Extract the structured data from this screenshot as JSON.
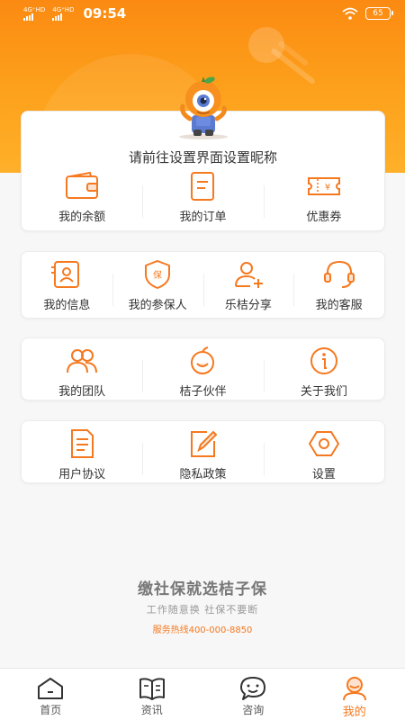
{
  "status_bar": {
    "signal_1": "4G⁺HD",
    "signal_2": "4G⁺HD",
    "time": "09:54",
    "battery": "65"
  },
  "colors": {
    "accent": "#f5791f",
    "header": "#fb8a12",
    "page_bg": "#f7f7f7"
  },
  "profile": {
    "nickname": "请前往设置界面设置昵称",
    "items": [
      {
        "label": "我的余额",
        "icon": "wallet-icon"
      },
      {
        "label": "我的订单",
        "icon": "order-icon"
      },
      {
        "label": "优惠券",
        "icon": "coupon-icon"
      }
    ]
  },
  "menu_group_1": [
    {
      "label": "我的信息",
      "icon": "id-card-icon"
    },
    {
      "label": "我的参保人",
      "icon": "shield-icon"
    },
    {
      "label": "乐桔分享",
      "icon": "user-add-icon"
    },
    {
      "label": "我的客服",
      "icon": "headset-icon"
    }
  ],
  "menu_group_2": [
    {
      "label": "我的团队",
      "icon": "team-icon"
    },
    {
      "label": "桔子伙伴",
      "icon": "orange-icon"
    },
    {
      "label": "关于我们",
      "icon": "info-icon"
    }
  ],
  "menu_group_3": [
    {
      "label": "用户协议",
      "icon": "document-icon"
    },
    {
      "label": "隐私政策",
      "icon": "edit-icon"
    },
    {
      "label": "设置",
      "icon": "settings-icon"
    }
  ],
  "promo": {
    "title": "缴社保就选桔子保",
    "subtitle": "工作随意换 社保不要断",
    "hotline": "服务热线400-000-8850"
  },
  "tab_bar": {
    "tabs": [
      {
        "label": "首页",
        "icon": "home-icon",
        "active": false
      },
      {
        "label": "资讯",
        "icon": "news-icon",
        "active": false
      },
      {
        "label": "咨询",
        "icon": "chat-icon",
        "active": false
      },
      {
        "label": "我的",
        "icon": "profile-icon",
        "active": true
      }
    ]
  }
}
